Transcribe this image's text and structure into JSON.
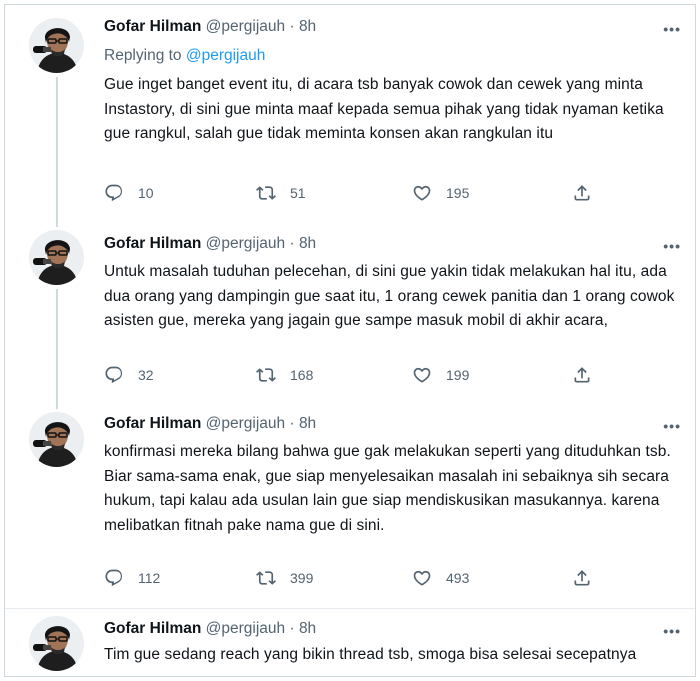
{
  "tweets": [
    {
      "name": "Gofar Hilman",
      "handle": "@pergijauh",
      "sep": " · ",
      "time": "8h",
      "replying_prefix": "Replying to ",
      "replying_handle": "@pergijauh",
      "text": "Gue inget banget event itu, di acara tsb banyak cowok dan cewek yang minta Instastory, di sini gue minta maaf kepada semua pihak yang tidak nyaman ketika gue rangkul, salah gue tidak meminta konsen akan rangkulan itu",
      "replies": "10",
      "retweets": "51",
      "likes": "195"
    },
    {
      "name": "Gofar Hilman",
      "handle": "@pergijauh",
      "sep": " · ",
      "time": "8h",
      "text": "Untuk masalah tuduhan pelecehan, di sini gue yakin tidak melakukan hal itu, ada dua orang yang dampingin gue saat itu, 1 orang cewek panitia dan 1 orang cowok asisten gue,  mereka yang jagain gue sampe masuk mobil di akhir acara,",
      "replies": "32",
      "retweets": "168",
      "likes": "199"
    },
    {
      "name": "Gofar Hilman",
      "handle": "@pergijauh",
      "sep": " · ",
      "time": "8h",
      "text": "konfirmasi mereka bilang bahwa gue gak melakukan seperti yang dituduhkan tsb. Biar sama-sama enak, gue siap menyelesaikan masalah ini sebaiknya sih secara hukum, tapi kalau ada usulan lain gue siap mendiskusikan masukannya. karena melibatkan fitnah pake nama gue di sini.",
      "replies": "112",
      "retweets": "399",
      "likes": "493"
    },
    {
      "name": "Gofar Hilman",
      "handle": "@pergijauh",
      "sep": " · ",
      "time": "8h",
      "text": "Tim gue sedang reach yang bikin thread tsb, smoga bisa selesai secepatnya"
    }
  ],
  "icons": {
    "reply": "reply-icon",
    "retweet": "retweet-icon",
    "like": "heart-icon",
    "share": "share-icon",
    "more": "more-icon"
  },
  "colors": {
    "accent": "#1d9bf0",
    "muted": "#536471",
    "text": "#0f1419"
  }
}
